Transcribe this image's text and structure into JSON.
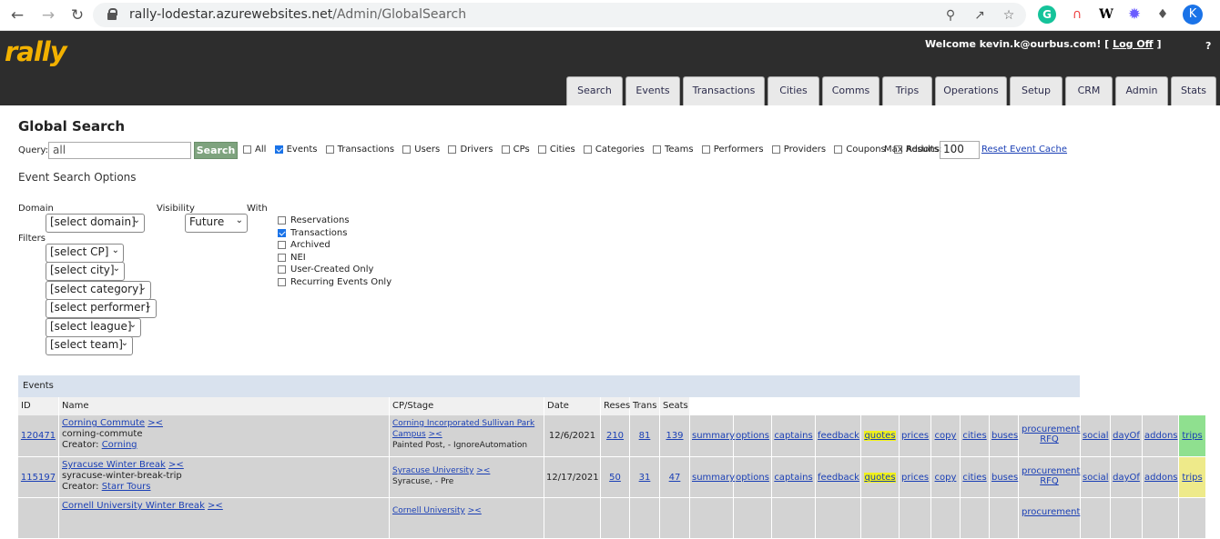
{
  "browser": {
    "url_host": "rally-lodestar.azurewebsites.net",
    "url_path": "/Admin/GlobalSearch",
    "avatar": "K",
    "icons": [
      "back-icon",
      "forward-icon",
      "reload-icon",
      "zoom-icon",
      "share-icon",
      "bookmark-star-icon",
      "grammarly-icon",
      "rainbow-icon",
      "wikipedia-icon",
      "asterisk-extension-icon",
      "puzzle-extensions-icon"
    ]
  },
  "header": {
    "logo": "rally",
    "welcome_prefix": "Welcome kevin.k@ourbus.com! [",
    "logoff": "Log Off",
    "welcome_suffix": "]",
    "help": "?"
  },
  "tabs": [
    "Search",
    "Events",
    "Transactions",
    "Cities",
    "Comms",
    "Trips",
    "Operations",
    "Setup",
    "CRM",
    "Admin",
    "Stats"
  ],
  "page": {
    "title": "Global Search",
    "query_label": "Query:",
    "query_value": "all",
    "search_button": "Search",
    "types": [
      {
        "label": "All",
        "checked": false
      },
      {
        "label": "Events",
        "checked": true
      },
      {
        "label": "Transactions",
        "checked": false
      },
      {
        "label": "Users",
        "checked": false
      },
      {
        "label": "Drivers",
        "checked": false
      },
      {
        "label": "CPs",
        "checked": false
      },
      {
        "label": "Cities",
        "checked": false
      },
      {
        "label": "Categories",
        "checked": false
      },
      {
        "label": "Teams",
        "checked": false
      },
      {
        "label": "Performers",
        "checked": false
      },
      {
        "label": "Providers",
        "checked": false
      },
      {
        "label": "Coupons",
        "checked": false
      },
      {
        "label": "Addons",
        "checked": false
      }
    ],
    "max_results_label": "Max Results:",
    "max_results_value": "100",
    "reset_link": "Reset Event Cache",
    "options_title": "Event Search Options",
    "domain_label": "Domain",
    "visibility_label": "Visibility",
    "with_label": "With",
    "filters_label": "Filters",
    "domain_select": "[select domain]",
    "visibility_select": "Future",
    "filters": [
      "[select CP]",
      "[select city]",
      "[select category]",
      "[select performer]",
      "[select league]",
      "[select team]"
    ],
    "with_options": [
      {
        "label": "Reservations",
        "checked": false
      },
      {
        "label": "Transactions",
        "checked": true
      },
      {
        "label": "Archived",
        "checked": false
      },
      {
        "label": "NEI",
        "checked": false
      },
      {
        "label": "User-Created Only",
        "checked": false
      },
      {
        "label": "Recurring Events Only",
        "checked": false
      }
    ]
  },
  "events": {
    "section_title": "Events",
    "columns": [
      "ID",
      "Name",
      "CP/Stage",
      "Date",
      "Reses",
      "Trans",
      "Seats"
    ],
    "link_actions": [
      "summary",
      "options",
      "captains",
      "feedback",
      "quotes",
      "prices",
      "copy",
      "cities",
      "buses"
    ],
    "procurement": [
      "procurement",
      "RFQ"
    ],
    "trailing_actions": [
      "social",
      "dayOf",
      "addons",
      "trips"
    ],
    "rows": [
      {
        "id": "120471",
        "name": "Corning Commute",
        "name_sfx": "><",
        "slug": "corning-commute",
        "creator_label": "Creator:",
        "creator": "Corning",
        "cp": "Corning Incorporated Sullivan Park Campus",
        "cp_sfx": "><",
        "stage": "Painted Post, - IgnoreAutomation",
        "date": "12/6/2021",
        "reses": "210",
        "trans": "81",
        "seats": "139"
      },
      {
        "id": "115197",
        "name": "Syracuse Winter Break",
        "name_sfx": "><",
        "slug": "syracuse-winter-break-trip",
        "creator_label": "Creator:",
        "creator": "Starr Tours",
        "cp": "Syracuse University",
        "cp_sfx": "><",
        "stage": "Syracuse, - Pre",
        "date": "12/17/2021",
        "reses": "50",
        "trans": "31",
        "seats": "47"
      },
      {
        "name": "Cornell University Winter Break",
        "name_sfx": "><",
        "cp": "Cornell University",
        "cp_sfx": "><",
        "proc": "procurement"
      }
    ]
  },
  "colors": {
    "header_bg": "#2d2d2d",
    "logo": "#f2b100",
    "search_btn": "#7ea37e",
    "row_bg": "#d3d3d3",
    "highlight": "#f1f11b",
    "trips_green": "#8fe08f",
    "trips_yellow": "#eeea8a"
  }
}
